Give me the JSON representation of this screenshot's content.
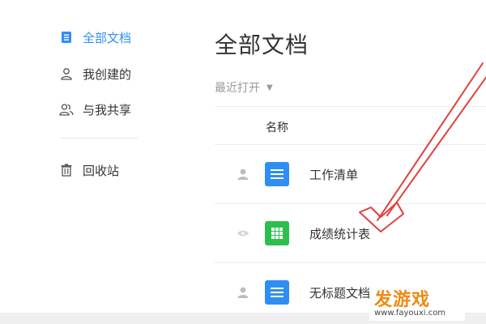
{
  "sidebar": {
    "items": [
      {
        "label": "全部文档",
        "icon": "documents-icon",
        "active": true
      },
      {
        "label": "我创建的",
        "icon": "user-icon",
        "active": false
      },
      {
        "label": "与我共享",
        "icon": "shared-users-icon",
        "active": false
      },
      {
        "label": "回收站",
        "icon": "trash-icon",
        "active": false
      }
    ]
  },
  "main": {
    "title": "全部文档",
    "sort_label": "最近打开",
    "column_name": "名称",
    "files": [
      {
        "name": "工作清单",
        "type": "document",
        "icon": "doc-file-icon",
        "owner_icon": "user-icon"
      },
      {
        "name": "成绩统计表",
        "type": "spreadsheet",
        "icon": "sheet-file-icon",
        "owner_icon": "eye-icon"
      },
      {
        "name": "无标题文档",
        "type": "document",
        "icon": "doc-file-icon",
        "owner_icon": "user-icon"
      }
    ]
  },
  "watermark": {
    "text": "发游戏",
    "url": "www.fayouxi.com"
  },
  "colors": {
    "accent": "#2f8ef4",
    "doc_blue": "#2f8ef4",
    "sheet_green": "#2dbf4e",
    "arrow_red": "#e04040",
    "watermark_orange": "#f08a12"
  }
}
